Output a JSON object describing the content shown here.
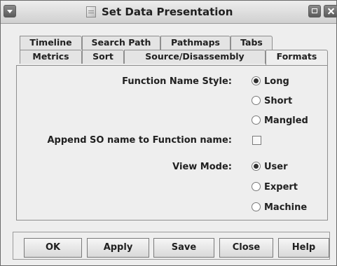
{
  "window": {
    "title": "Set Data Presentation"
  },
  "tabs": {
    "row1": [
      "Timeline",
      "Search Path",
      "Pathmaps",
      "Tabs"
    ],
    "row2": [
      "Metrics",
      "Sort",
      "Source/Disassembly",
      "Formats"
    ],
    "selected": "Formats"
  },
  "formats": {
    "function_name_style_label": "Function Name Style:",
    "function_name_style_options": [
      "Long",
      "Short",
      "Mangled"
    ],
    "function_name_style_selected": "Long",
    "append_so_label": "Append SO name to Function name:",
    "append_so_checked": false,
    "view_mode_label": "View Mode:",
    "view_mode_options": [
      "User",
      "Expert",
      "Machine"
    ],
    "view_mode_selected": "User"
  },
  "buttons": {
    "ok": "OK",
    "apply": "Apply",
    "save": "Save",
    "close": "Close",
    "help": "Help"
  }
}
